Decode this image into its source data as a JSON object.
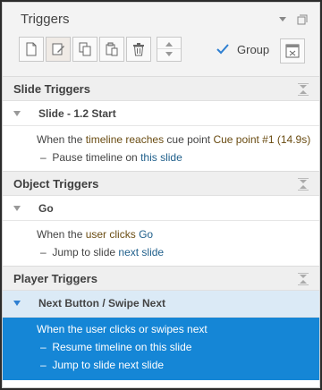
{
  "header": {
    "title": "Triggers",
    "group_label": "Group",
    "group_checked": true
  },
  "toolbar": {
    "buttons": [
      "new-trigger",
      "edit-trigger",
      "copy",
      "paste",
      "delete"
    ],
    "accent": "#2e7fd1"
  },
  "sections": {
    "slide": {
      "title": "Slide Triggers",
      "subgroup": "Slide - 1.2 Start",
      "line1": {
        "p1": "When the ",
        "k1": "timeline reaches",
        "p2": " cue point ",
        "v1": "Cue point #1",
        "v2": " (14.9s)"
      },
      "line2": {
        "p1": "Pause timeline on ",
        "l1": "this slide"
      }
    },
    "object": {
      "title": "Object Triggers",
      "subgroup": "Go",
      "line1": {
        "p1": "When the ",
        "k1": "user clicks",
        "p2": " ",
        "l1": "Go"
      },
      "line2": {
        "p1": "Jump to slide ",
        "l1": "next slide"
      }
    },
    "player": {
      "title": "Player Triggers",
      "subgroup": "Next Button / Swipe Next",
      "line1": "When the user clicks or swipes next",
      "line2": "Resume timeline on this slide",
      "line3": "Jump to slide next slide"
    }
  },
  "colors": {
    "selection_bg": "#1586d6",
    "selected_group_bg": "#dbeaf6",
    "link": "#1f5f8b",
    "keyword": "#6a4c12"
  }
}
